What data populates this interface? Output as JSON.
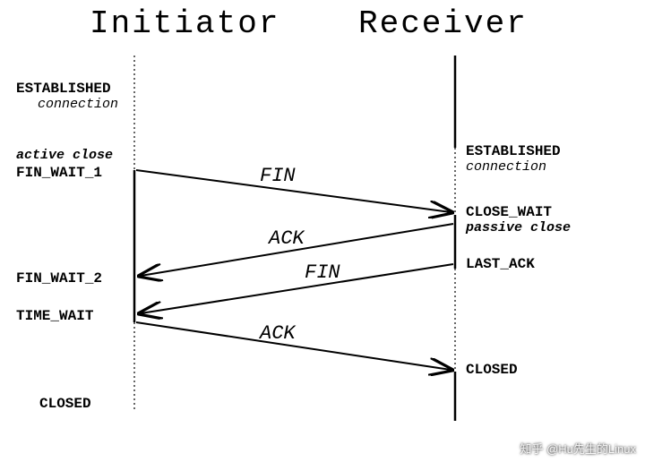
{
  "header": {
    "left": "Initiator",
    "right": "Receiver"
  },
  "left": {
    "established": "ESTABLISHED",
    "established_sub": "connection",
    "active_close": "active close",
    "fin_wait_1": "FIN_WAIT_1",
    "fin_wait_2": "FIN_WAIT_2",
    "time_wait": "TIME_WAIT",
    "closed": "CLOSED"
  },
  "right": {
    "established": "ESTABLISHED",
    "established_sub": "connection",
    "close_wait": "CLOSE_WAIT",
    "passive_close": "passive close",
    "last_ack": "LAST_ACK",
    "closed": "CLOSED"
  },
  "messages": {
    "fin1": "FIN",
    "ack1": "ACK",
    "fin2": "FIN",
    "ack2": "ACK"
  },
  "watermark": "知乎 @Hu先生的Linux"
}
